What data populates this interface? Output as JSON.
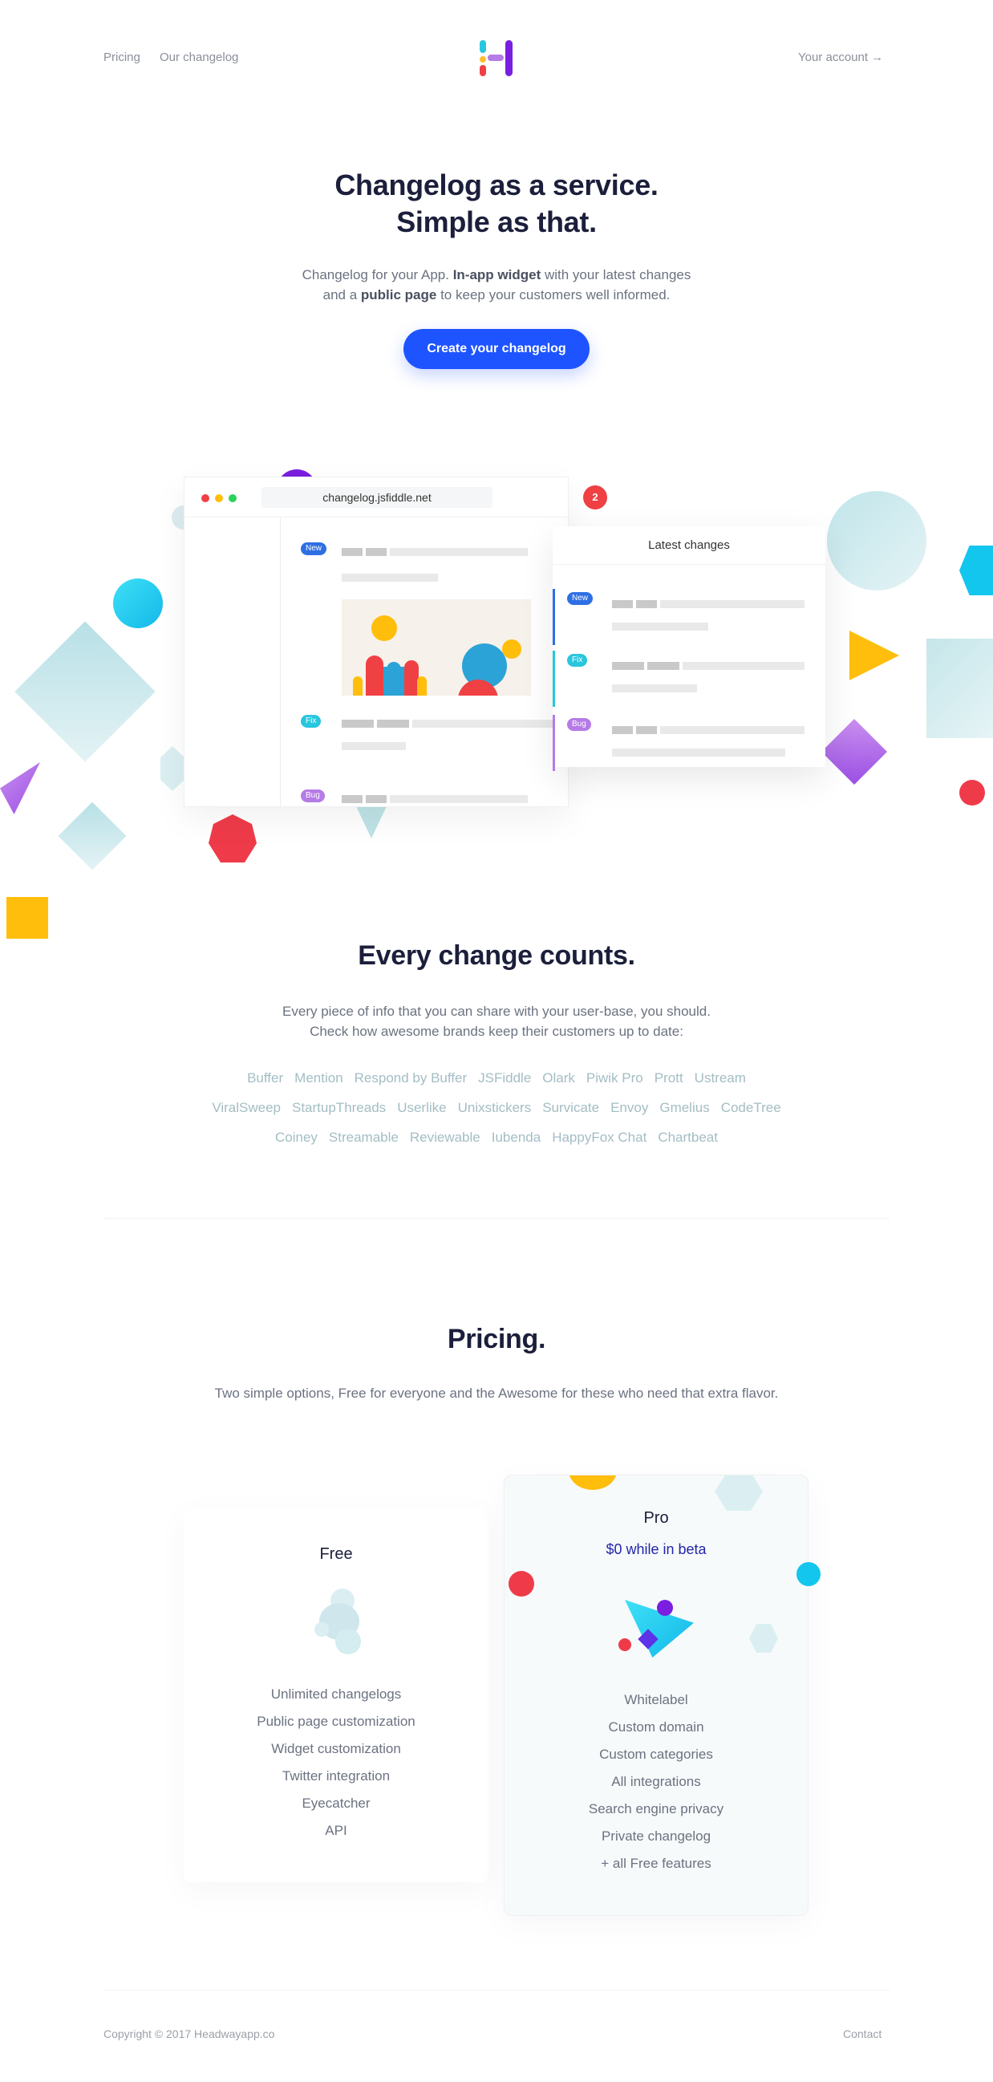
{
  "nav": {
    "pricing": "Pricing",
    "changelog": "Our changelog",
    "account": "Your account →"
  },
  "hero": {
    "title_line1": "Changelog as a service.",
    "title_line2": "Simple as that.",
    "sub_pre": "Changelog for your App. ",
    "sub_b1": "In-app widget",
    "sub_mid": " with your latest changes",
    "sub_pre2": "and a ",
    "sub_b2": "public page",
    "sub_post": " to keep your customers well informed.",
    "cta": "Create your changelog"
  },
  "mock": {
    "url": "changelog.jsfiddle.net",
    "tags": {
      "new": "New",
      "fix": "Fix",
      "bug": "Bug"
    },
    "widget_title": "Latest changes",
    "badge_count": "2"
  },
  "counts": {
    "title": "Every change counts.",
    "sub1": "Every piece of info that you can share with your user-base, you should.",
    "sub2": "Check how awesome brands keep their customers up to date:",
    "brands_row1": [
      "Buffer",
      "Mention",
      "Respond by Buffer",
      "JSFiddle",
      "Olark",
      "Piwik Pro",
      "Prott",
      "Ustream"
    ],
    "brands_row2": [
      "ViralSweep",
      "StartupThreads",
      "Userlike",
      "Unixstickers",
      "Survicate",
      "Envoy",
      "Gmelius",
      "CodeTree"
    ],
    "brands_row3": [
      "Coiney",
      "Streamable",
      "Reviewable",
      "Iubenda",
      "HappyFox Chat",
      "Chartbeat"
    ]
  },
  "pricing": {
    "title": "Pricing.",
    "sub": "Two simple options, Free for everyone and the Awesome for these who need that extra flavor.",
    "free": {
      "name": "Free",
      "features": [
        "Unlimited changelogs",
        "Public page customization",
        "Widget customization",
        "Twitter integration",
        "Eyecatcher",
        "API"
      ]
    },
    "pro": {
      "name": "Pro",
      "price": "$0 while in beta",
      "features": [
        "Whitelabel",
        "Custom domain",
        "Custom categories",
        "All integrations",
        "Search engine privacy",
        "Private changelog",
        "+ all Free features"
      ]
    }
  },
  "footer": {
    "copyright": "Copyright © 2017 Headwayapp.co",
    "contact": "Contact"
  },
  "colors": {
    "accent": "#1e54ff",
    "new": "#2f6fe4",
    "fix": "#29c6de",
    "bug": "#b57be6",
    "badge": "#ef4044"
  }
}
